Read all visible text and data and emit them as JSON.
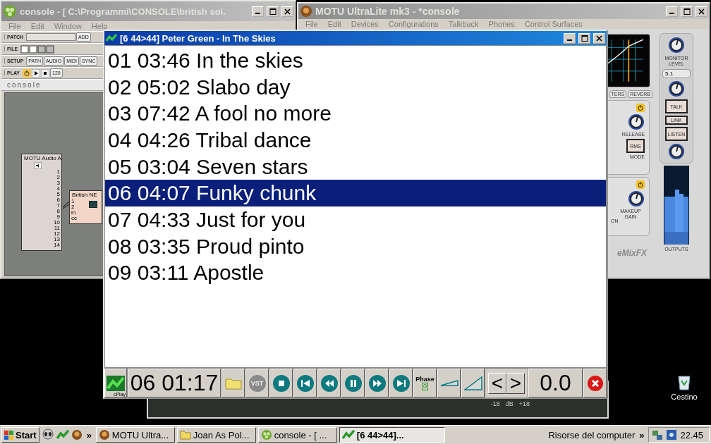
{
  "console_window": {
    "title": "console - [ C:\\Programmi\\CONSOLE\\british sol.",
    "menu": [
      "File",
      "Edit",
      "Window",
      "Help"
    ],
    "patch_label": "PATCH",
    "add_button": "ADD",
    "file_label": "FILE",
    "setup_label": "SETUP",
    "setup_buttons": [
      "PATH",
      "AUDIO",
      "MIDI",
      "SYNC"
    ],
    "play_label": "PLAY",
    "tempo": "120",
    "logo": "console",
    "modules": [
      {
        "title": "MOTU Audio A",
        "kind": "output",
        "ports": [
          "1",
          "2",
          "3",
          "4",
          "5",
          "6",
          "7",
          "8",
          "9",
          "10",
          "11",
          "12",
          "13",
          "14"
        ]
      },
      {
        "title": "British NE",
        "kind": "effect",
        "ports": [
          "1",
          "2",
          "in",
          "cc"
        ]
      }
    ]
  },
  "motu_window": {
    "title": "MOTU UltraLite mk3 - *console",
    "menu": [
      "File",
      "Edit",
      "Devices",
      "Configurations",
      "Talkback",
      "Phones",
      "Control Surfaces"
    ],
    "tabs": [
      {
        "label": "TERS",
        "selected": false
      },
      {
        "label": "REVERB",
        "selected": false
      }
    ],
    "release_label": "RELEASE",
    "rms_button": "RMS",
    "mode_label": "MODE",
    "on_label": "ON",
    "makeup_label": "MAKEUP GAIN",
    "brand": "eMixFX",
    "monitor_label": "MONITOR LEVEL",
    "monitor_select": "5.1",
    "talk_button": "TALK",
    "link_button": "LINK",
    "listen_button": "LISTEN",
    "outputs_label": "OUTPUTS"
  },
  "mixer_window": {
    "scale": [
      "-18",
      "dB",
      "+18"
    ]
  },
  "player": {
    "title": "[6 44>44] Peter Green - In The Skies",
    "tracks": [
      {
        "text": "01 03:46 In the skies",
        "selected": false
      },
      {
        "text": "02 05:02 Slabo day",
        "selected": false
      },
      {
        "text": "03 07:42 A fool no more",
        "selected": false
      },
      {
        "text": "04 04:26 Tribal dance",
        "selected": false
      },
      {
        "text": "05 03:04 Seven stars",
        "selected": false
      },
      {
        "text": "06 04:07 Funky chunk",
        "selected": true
      },
      {
        "text": "07 04:33 Just for you",
        "selected": false
      },
      {
        "text": "08 03:35 Proud pinto",
        "selected": false
      },
      {
        "text": "09 03:11 Apostle",
        "selected": false
      }
    ],
    "logo": "cPlay",
    "position": "06 01:17",
    "vst_button": "VST",
    "phase_label": "Phase",
    "phase_value": "0",
    "nav": [
      "<",
      ">"
    ],
    "volume": "0.0"
  },
  "desktop_icons": [
    {
      "label": "Cestino"
    }
  ],
  "taskbar": {
    "start": "Start",
    "quick_more": "»",
    "tasks": [
      {
        "label": "MOTU Ultra...",
        "kind": "motu",
        "selected": false
      },
      {
        "label": "Joan As Pol...",
        "kind": "folder",
        "selected": false
      },
      {
        "label": "console - [ ...",
        "kind": "console",
        "selected": false
      },
      {
        "label": "[6 44>44]...",
        "kind": "player",
        "selected": true
      }
    ],
    "toolbar_label": "Risorse del computer",
    "toolbar_more": "»",
    "clock": "22.45"
  }
}
